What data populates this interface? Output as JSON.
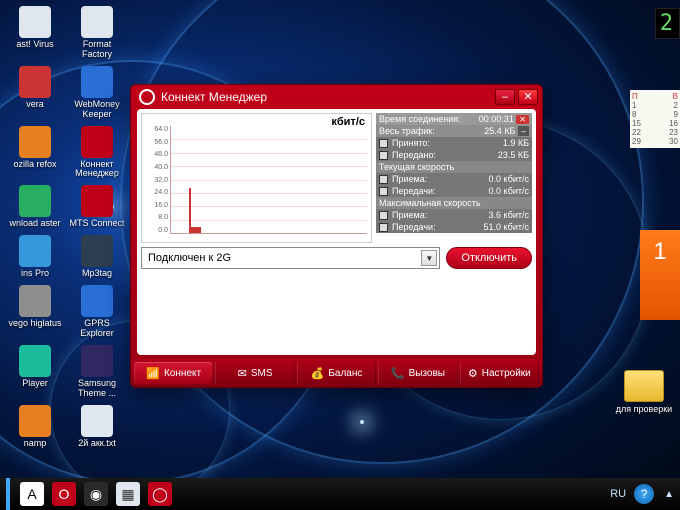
{
  "desktop_icons": [
    {
      "label": "ast! Virus",
      "color": "#e0e6ee"
    },
    {
      "label": "Format Factory",
      "color": "#e0e6ee"
    },
    {
      "label": "vera",
      "color": "#c33"
    },
    {
      "label": "WebMoney Keeper",
      "color": "#2a6fd6"
    },
    {
      "label": "ozilla refox",
      "color": "#e67e22"
    },
    {
      "label": "Коннект Менеджер",
      "color": "#c00018"
    },
    {
      "label": "wnload aster",
      "color": "#27ae60"
    },
    {
      "label": "MTS Connect",
      "color": "#c00018"
    },
    {
      "label": "ins Pro",
      "color": "#3498db"
    },
    {
      "label": "Mp3tag",
      "color": "#2c3e50"
    },
    {
      "label": "vego higlatus",
      "color": "#8e8e8e"
    },
    {
      "label": "GPRS Explorer",
      "color": "#2a6fd6"
    },
    {
      "label": "Player",
      "color": "#1abc9c"
    },
    {
      "label": "Samsung Theme ...",
      "color": "#302860"
    },
    {
      "label": "namp",
      "color": "#e67e22"
    },
    {
      "label": "2й акк.txt",
      "color": "#dfe6ee"
    }
  ],
  "clock": "2",
  "calendar": {
    "header": [
      "П",
      "В"
    ],
    "rows": [
      [
        "",
        ""
      ],
      [
        "1",
        "2"
      ],
      [
        "8",
        "9"
      ],
      [
        "15",
        "16"
      ],
      [
        "22",
        "23"
      ],
      [
        "29",
        "30"
      ]
    ]
  },
  "orange_widget": "1",
  "folder": {
    "label": "для проверки"
  },
  "taskbar": {
    "icons": [
      {
        "name": "app-a",
        "bg": "#fff",
        "fg": "#000",
        "text": "A"
      },
      {
        "name": "opera",
        "bg": "#c00018",
        "fg": "#fff",
        "text": "O"
      },
      {
        "name": "chrome",
        "bg": "#2a2a2a",
        "fg": "#fff",
        "text": "◉"
      },
      {
        "name": "calc",
        "bg": "#dfe6ee",
        "fg": "#333",
        "text": "▦"
      },
      {
        "name": "connect-manager",
        "bg": "#c00018",
        "fg": "#fff",
        "text": "◯"
      }
    ],
    "lang": "RU"
  },
  "window": {
    "title": "Коннект Менеджер",
    "chart": {
      "unit": "кбит/с",
      "yticks": [
        "64.0",
        "56.0",
        "48.0",
        "40.0",
        "32.0",
        "24.0",
        "16.0",
        "8.0",
        "0.0"
      ]
    },
    "stats": {
      "conn_time_label": "Время соединения:",
      "conn_time_value": "00:00:31",
      "traffic_label": "Весь трафик:",
      "traffic_value": "25.4 КБ",
      "rx_label": "Принято:",
      "rx_value": "1.9 КБ",
      "tx_label": "Передано:",
      "tx_value": "23.5 КБ",
      "cur_head": "Текущая скорость",
      "cur_rx_label": "Приема:",
      "cur_rx_value": "0.0 кбит/с",
      "cur_tx_label": "Передачи:",
      "cur_tx_value": "0.0 кбит/с",
      "max_head": "Максимальная скорость",
      "max_rx_label": "Приема:",
      "max_rx_value": "3.6 кбит/с",
      "max_tx_label": "Передачи:",
      "max_tx_value": "51.0 кбит/с"
    },
    "status": "Подключен к 2G",
    "disconnect": "Отключить",
    "nav": [
      {
        "name": "connect",
        "label": "Коннект",
        "icon": "📶"
      },
      {
        "name": "sms",
        "label": "SMS",
        "icon": "✉"
      },
      {
        "name": "balance",
        "label": "Баланс",
        "icon": "💰"
      },
      {
        "name": "calls",
        "label": "Вызовы",
        "icon": "📞"
      },
      {
        "name": "settings",
        "label": "Настройки",
        "icon": "⚙"
      }
    ]
  },
  "chart_data": {
    "type": "line",
    "title": "кбит/с",
    "ylabel": "кбит/с",
    "ylim": [
      0,
      64
    ],
    "x": [
      0,
      1,
      2,
      3,
      4,
      5,
      6,
      7,
      8,
      9,
      10,
      11,
      12,
      13,
      14,
      15,
      16,
      17,
      18,
      19,
      20,
      21,
      22,
      23,
      24,
      25,
      26,
      27,
      28,
      29,
      30
    ],
    "series": [
      {
        "name": "Приема",
        "values": [
          0,
          0,
          0,
          0,
          0,
          0,
          0,
          3.6,
          1,
          0.5,
          0,
          0,
          0,
          0,
          0,
          0,
          0,
          0,
          0,
          0,
          0,
          0,
          0,
          0,
          0,
          0,
          0,
          0,
          0,
          0,
          0
        ]
      },
      {
        "name": "Передачи",
        "values": [
          0,
          0,
          0,
          0,
          0,
          0,
          0,
          51,
          8,
          2,
          0,
          0,
          0,
          0,
          0,
          0,
          0,
          0,
          0,
          0,
          0,
          0,
          0,
          0,
          0,
          0,
          0,
          0,
          0,
          0,
          0
        ]
      }
    ]
  }
}
